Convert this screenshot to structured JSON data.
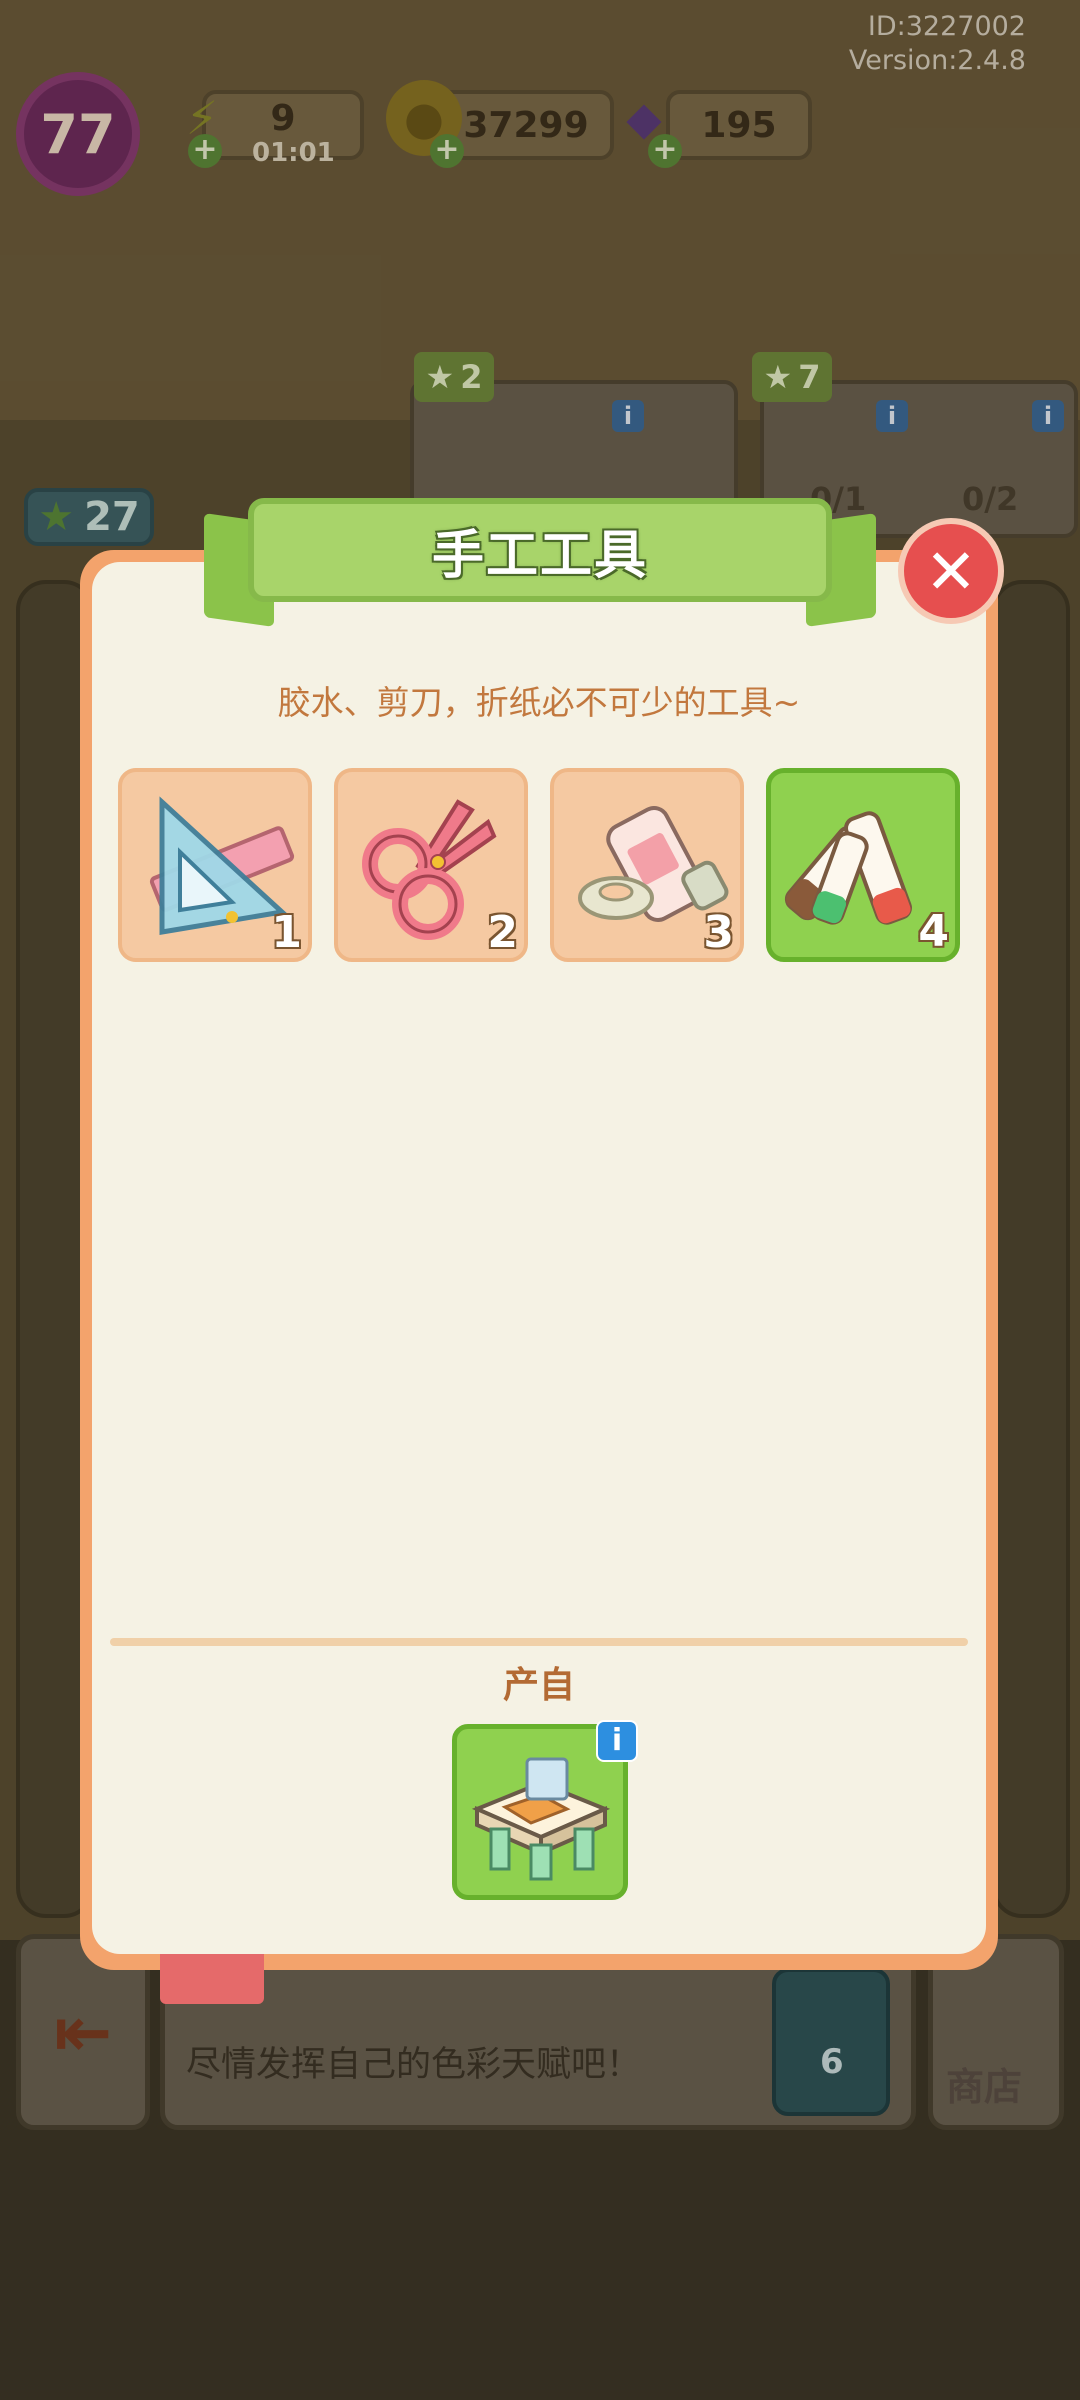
{
  "hud": {
    "id_text": "ID:3227002",
    "version_text": "Version:2.4.8",
    "level": "77",
    "energy": "9",
    "energy_timer": "01:01",
    "coins": "37299",
    "gems": "195"
  },
  "background": {
    "left_star_count": "27",
    "order_stars_1": "2",
    "order_stars_2": "7",
    "order_progress_1": "0/1",
    "order_progress_2": "0/2",
    "bottom_message": "尽情发挥自己的色彩天赋吧！",
    "coin_button_value": "6",
    "shop_label": "商店"
  },
  "dialog": {
    "title": "手工工具",
    "description": "胶水、剪刀，折纸必不可少的工具~",
    "close_label": "✕",
    "items": [
      {
        "name": "ruler-triangle",
        "level": "1",
        "selected": false
      },
      {
        "name": "scissors",
        "level": "2",
        "selected": false
      },
      {
        "name": "glue-and-tape",
        "level": "3",
        "selected": false
      },
      {
        "name": "markers",
        "level": "4",
        "selected": true
      }
    ],
    "source_label": "产自",
    "source_info": "i"
  },
  "colors": {
    "dialog_bg": "#f5f2e4",
    "dialog_border": "#f3a36c",
    "title_green": "#a8d46a",
    "slot_bg": "#f5c9a2",
    "slot_selected": "#8fd14f",
    "close_red": "#e64f4f",
    "accent_text": "#c2783e"
  }
}
